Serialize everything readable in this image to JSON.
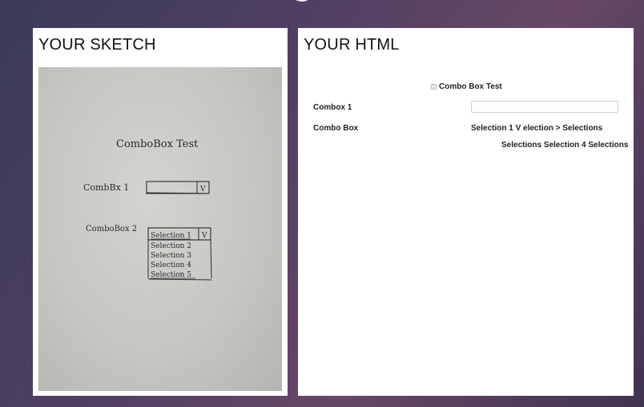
{
  "sketch_panel": {
    "title": "YOUR SKETCH",
    "photo": {
      "title": "ComboBox  Test",
      "label1": "CombBx 1",
      "label2": "ComboBox 2",
      "dropdown_arrow": "V",
      "options": [
        "Selection 1",
        "Selection 2",
        "Selection 3",
        "Selection 4",
        "Selection 5"
      ]
    }
  },
  "html_panel": {
    "title": "YOUR HTML",
    "form_title": "Combo Box Test",
    "label_combox1": "Combox 1",
    "label_combobox": "Combo Box",
    "combo_line1": "Selection 1 V election > Selections",
    "combo_line2": "Selections Selection 4 Selections"
  }
}
